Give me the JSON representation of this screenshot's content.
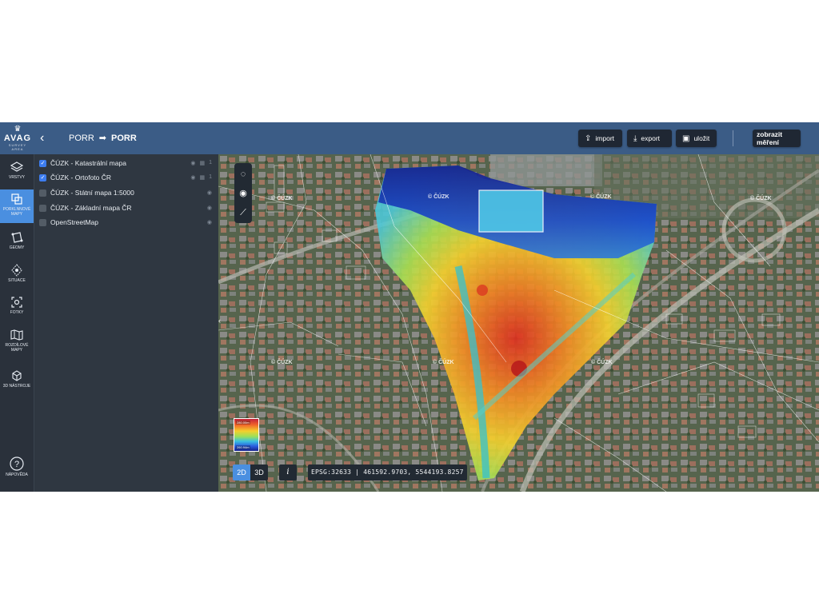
{
  "header": {
    "logo": {
      "word": "AVAG",
      "sub": "SURVEY AREA"
    },
    "back_icon": "chevron-left",
    "breadcrumb": [
      "PORR",
      "PORR"
    ],
    "buttons": {
      "import": "import",
      "export": "export",
      "save": "uložit",
      "download_measurements": "zobrazit měření"
    }
  },
  "rail": [
    {
      "label": "VRSTVY",
      "icon": "layers-icon"
    },
    {
      "label": "PORKLNNOVÉ MAPY",
      "icon": "maps-icon",
      "active": true
    },
    {
      "label": "GEOMY",
      "icon": "geometry-icon"
    },
    {
      "label": "SITUACE",
      "icon": "situation-icon"
    },
    {
      "label": "FOTKY",
      "icon": "photo-icon"
    },
    {
      "label": "ROZDÍLOVÉ MAPY",
      "icon": "diff-map-icon"
    },
    {
      "label": "3D NÁSTROJE",
      "icon": "cube-icon"
    },
    {
      "label": "NÁPOVĚDA",
      "icon": "help-icon"
    }
  ],
  "layers": [
    {
      "label": "ČÚZK - Katastrální mapa",
      "checked": true,
      "extra": "1"
    },
    {
      "label": "ČÚZK - Ortofoto ČR",
      "checked": true,
      "extra": "1"
    },
    {
      "label": "ČÚZK - Státní mapa 1:5000",
      "checked": false,
      "extra": ""
    },
    {
      "label": "ČÚZK - Základní mapa ČR",
      "checked": false,
      "extra": ""
    },
    {
      "label": "OpenStreetMap",
      "checked": false,
      "extra": ""
    }
  ],
  "map": {
    "watermark": "© ČÚZK",
    "legend": {
      "max": "280.00m",
      "min": "260.94m"
    },
    "view_modes": {
      "two_d": "2D",
      "three_d": "3D",
      "active": "2D"
    },
    "info_label": "i",
    "coordinates": "EPSG:32633 | 461592.9703, 5544193.8257",
    "tools": [
      "polygon-icon",
      "point-icon",
      "line-icon"
    ]
  },
  "colors": {
    "header": "#3b5c86",
    "rail": "#2a313b",
    "panel": "#2f3741",
    "accent": "#4a8fe0"
  }
}
